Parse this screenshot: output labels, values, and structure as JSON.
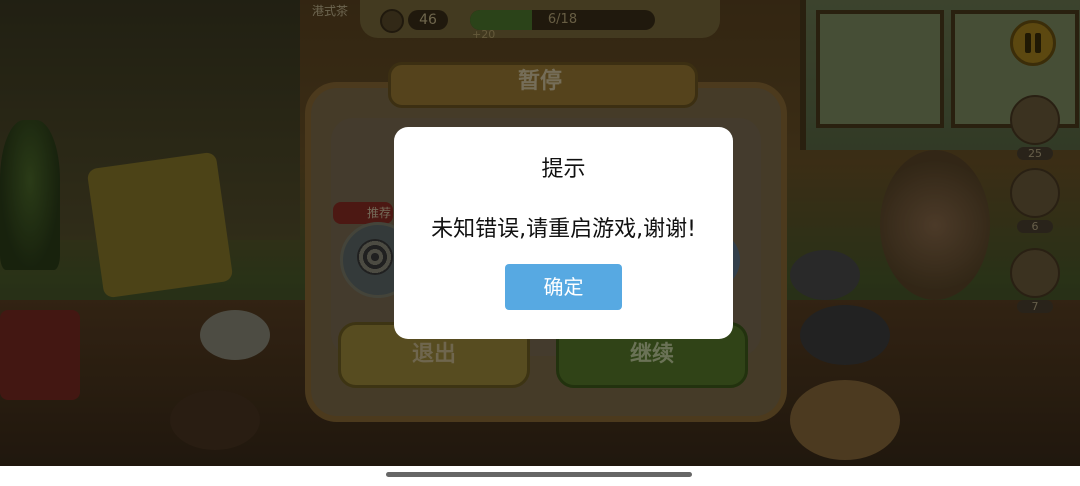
{
  "hud": {
    "label": "港式茶",
    "timer": "46",
    "progress_text": "6/18",
    "progress_fraction": 0.333,
    "progress_extra": "+20"
  },
  "orders": [
    {
      "count": "25"
    },
    {
      "count": "6"
    },
    {
      "count": "7"
    }
  ],
  "pause_menu": {
    "title": "暂停",
    "recommend_tag": "推荐",
    "exit_label": "退出",
    "continue_label": "继续"
  },
  "dialog": {
    "title": "提示",
    "message": "未知错误,请重启游戏,谢谢!",
    "ok_label": "确定",
    "accent": "#57a9e2"
  }
}
